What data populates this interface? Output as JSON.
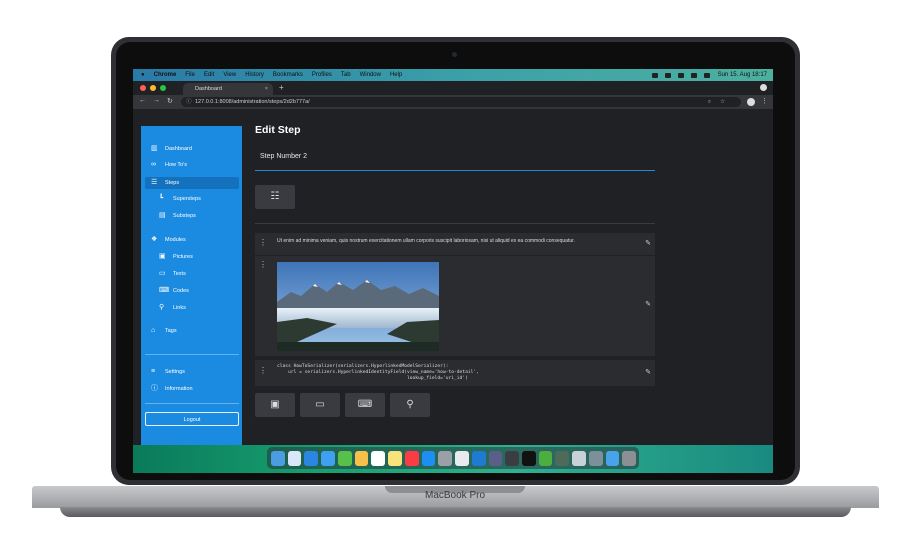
{
  "laptop": {
    "brand": "MacBook Pro"
  },
  "menubar": {
    "app": "Chrome",
    "items": [
      "File",
      "Edit",
      "View",
      "History",
      "Bookmarks",
      "Profiles",
      "Tab",
      "Window",
      "Help"
    ],
    "clock": "Sun 15. Aug  18:17"
  },
  "browser": {
    "tab_title": "Dashboard",
    "url": "127.0.0.1:8008/administration/steps/2d2b777a/"
  },
  "sidebar": {
    "items": [
      {
        "label": "Dashboard",
        "icon": "dashboard-icon"
      },
      {
        "label": "How To's",
        "icon": "glasses-icon"
      },
      {
        "label": "Steps",
        "icon": "list-icon"
      },
      {
        "label": "Supersteps",
        "icon": "tree-icon"
      },
      {
        "label": "Substeps",
        "icon": "stack-icon"
      },
      {
        "label": "Modules",
        "icon": "modules-icon"
      },
      {
        "label": "Pictures",
        "icon": "picture-icon"
      },
      {
        "label": "Texts",
        "icon": "text-icon"
      },
      {
        "label": "Codes",
        "icon": "code-icon"
      },
      {
        "label": "Links",
        "icon": "link-icon"
      },
      {
        "label": "Tags",
        "icon": "tag-icon"
      },
      {
        "label": "Settings",
        "icon": "settings-icon"
      },
      {
        "label": "Information",
        "icon": "info-icon"
      }
    ],
    "logout": "Logout"
  },
  "main": {
    "title": "Edit Step",
    "step_name": "Step Number 2",
    "text_module": "Ut enim ad minima veniam, quis nostrum exercitationem ullam corporis suscipit laboriosam, nisi ut aliquid ex ea commodi consequatur.",
    "code_module": "class HowToSerializer(serializers.HyperlinkedModelSerializer):\n    url = serializers.HyperlinkedIdentityField(view_name='how-to-detail',\n                                               lookup_field='uri_id')"
  },
  "colors": {
    "sidebar": "#1a8be0",
    "background": "#1f2125",
    "accent_line": "#2b87d0"
  }
}
